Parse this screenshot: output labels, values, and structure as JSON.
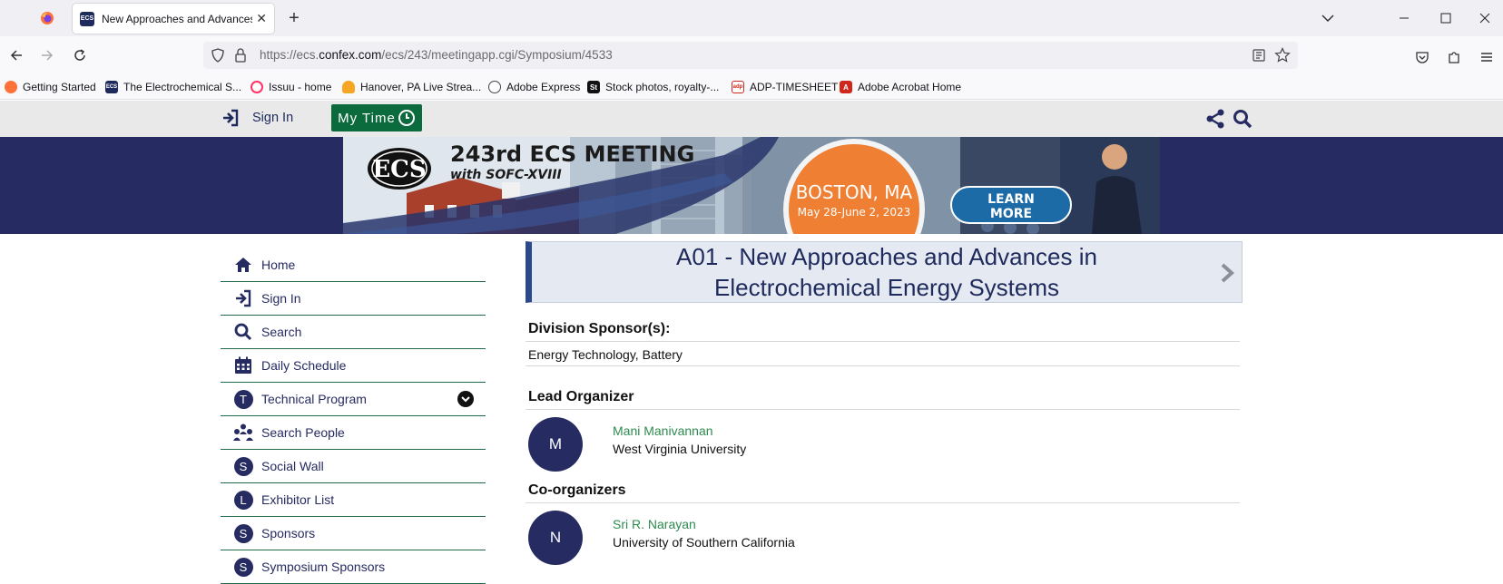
{
  "browser": {
    "tab_title": "New Approaches and Advances",
    "url_prefix": "https://ecs.",
    "url_domain": "confex.com",
    "url_rest": "/ecs/243/meetingapp.cgi/Symposium/4533",
    "bookmarks": [
      {
        "label": "Getting Started",
        "icon": "firefox-icon"
      },
      {
        "label": "The Electrochemical S...",
        "icon": "ecs-icon"
      },
      {
        "label": "Issuu - home",
        "icon": "issuu-icon"
      },
      {
        "label": "Hanover, PA Live Strea...",
        "icon": "cloud-icon"
      },
      {
        "label": "Adobe Express",
        "icon": "globe-icon"
      },
      {
        "label": "Stock photos, royalty-...",
        "icon": "st-icon"
      },
      {
        "label": "ADP-TIMESHEET",
        "icon": "adp-icon"
      },
      {
        "label": "Adobe Acrobat Home",
        "icon": "acrobat-icon"
      }
    ]
  },
  "site": {
    "sign_in_label": "Sign In",
    "my_time_label": "My Time",
    "banner": {
      "meeting": "243rd ECS MEETING",
      "subtitle": "with SOFC-XVIII",
      "logo": "ECS",
      "city": "BOSTON, MA",
      "dates": "May 28-June 2, 2023",
      "cta_line1": "LEARN",
      "cta_line2": "MORE"
    }
  },
  "sidebar": {
    "items": [
      {
        "label": "Home",
        "icon": "home-icon"
      },
      {
        "label": "Sign In",
        "icon": "sign-in-icon"
      },
      {
        "label": "Search",
        "icon": "search-icon"
      },
      {
        "label": "Daily Schedule",
        "icon": "calendar-icon"
      },
      {
        "label": "Technical Program",
        "icon": "T"
      },
      {
        "label": "Search People",
        "icon": "people-icon"
      },
      {
        "label": "Social Wall",
        "icon": "S"
      },
      {
        "label": "Exhibitor List",
        "icon": "L"
      },
      {
        "label": "Sponsors",
        "icon": "S"
      },
      {
        "label": "Symposium Sponsors",
        "icon": "S"
      }
    ]
  },
  "symposium": {
    "title": "A01 - New Approaches and Advances in Electrochemical Energy Systems",
    "division_heading": "Division Sponsor(s):",
    "division_value": "Energy Technology, Battery",
    "lead_heading": "Lead Organizer",
    "lead": {
      "initial": "M",
      "name": "Mani Manivannan",
      "affiliation": "West Virginia University"
    },
    "co_heading": "Co-organizers",
    "co": {
      "initial": "N",
      "name": "Sri R. Narayan",
      "affiliation": "University of Southern California"
    }
  }
}
